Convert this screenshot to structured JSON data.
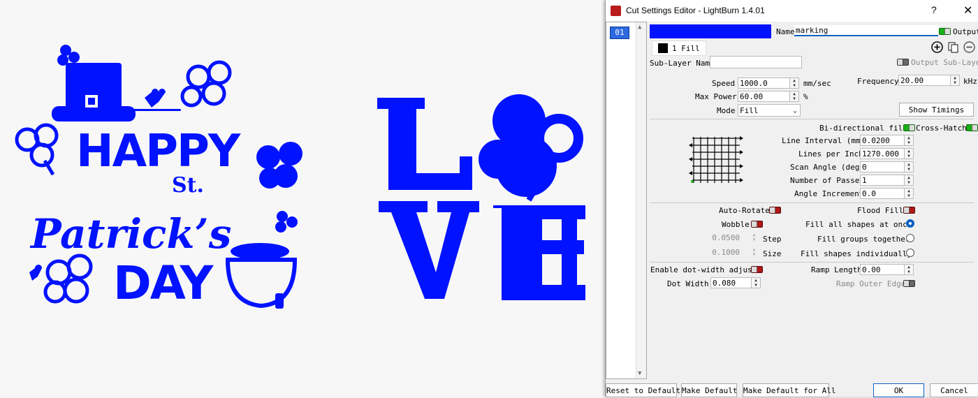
{
  "colors": {
    "artwork": "#0012ff",
    "layer": "#0012ff",
    "toggle_on": "#17b117",
    "toggle_off": "#b11717"
  },
  "dialog": {
    "title": "Cut Settings Editor - LightBurn 1.4.01",
    "help": "?",
    "close": "✕"
  },
  "layers": [
    {
      "label": "01"
    }
  ],
  "top": {
    "name_label": "Name",
    "name_value": "marking",
    "output_label": "Output",
    "sublayer_tab": "1 Fill",
    "sublayer_name_label": "Sub-Layer Name",
    "sublayer_name_value": "",
    "output_sublayer_label": "Output Sub-Layer",
    "add_icon": "plus-circle-icon",
    "copy_icon": "copy-icon",
    "remove_icon": "minus-circle-icon"
  },
  "params": {
    "speed_label": "Speed",
    "speed_value": "1000.0",
    "speed_unit": "mm/sec",
    "max_power_label": "Max Power",
    "max_power_value": "60.00",
    "max_power_unit": "%",
    "mode_label": "Mode",
    "mode_value": "Fill",
    "frequency_label": "Frequency",
    "frequency_value": "20.00",
    "frequency_unit": "kHz",
    "show_timings": "Show Timings"
  },
  "fill": {
    "bidir_label": "Bi-directional fill",
    "crosshatch_label": "Cross-Hatch",
    "line_interval_label": "Line Interval (mm)",
    "line_interval_value": "0.0200",
    "lpi_label": "Lines per Inch",
    "lpi_value": "1270.000",
    "scan_angle_label": "Scan Angle (deg)",
    "scan_angle_value": "0",
    "passes_label": "Number of Passes",
    "passes_value": "1",
    "angle_inc_label": "Angle Increment",
    "angle_inc_value": "0.0"
  },
  "options": {
    "auto_rotate": "Auto-Rotate",
    "flood_fill": "Flood Fill",
    "wobble": "Wobble",
    "fill_all": "Fill all shapes at once",
    "step_value": "0.0500",
    "step_label": "Step",
    "fill_groups": "Fill groups together",
    "size_value": "0.1000",
    "size_label": "Size",
    "fill_individually": "Fill shapes individually",
    "dot_width_adjust": "Enable dot-width adjust",
    "ramp_length_label": "Ramp Length",
    "ramp_length_value": "0.00",
    "dot_width_label": "Dot Width:",
    "dot_width_value": "0.080",
    "ramp_outer_edge": "Ramp Outer Edge"
  },
  "footer": {
    "reset": "Reset to Default",
    "make_default": "Make Default",
    "make_default_all": "Make Default for All",
    "ok": "OK",
    "cancel": "Cancel"
  }
}
